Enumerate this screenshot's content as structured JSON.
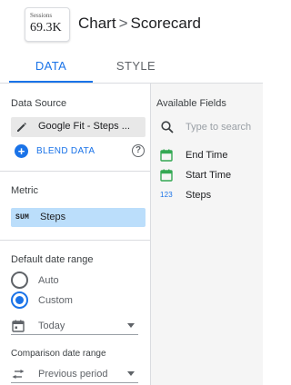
{
  "header": {
    "thumbnail": {
      "label": "Sessions",
      "value": "69.3K"
    },
    "breadcrumb": [
      "Chart",
      "Scorecard"
    ],
    "separator": ">"
  },
  "tabs": [
    {
      "label": "DATA",
      "active": true
    },
    {
      "label": "STYLE",
      "active": false
    }
  ],
  "data_source": {
    "title": "Data Source",
    "source_name": "Google Fit - Steps ...",
    "blend_label": "BLEND DATA",
    "help_glyph": "?"
  },
  "metric": {
    "title": "Metric",
    "badge": "SUM",
    "field": "Steps"
  },
  "date_range": {
    "title": "Default date range",
    "options": [
      {
        "label": "Auto",
        "checked": false
      },
      {
        "label": "Custom",
        "checked": true
      }
    ],
    "custom_value": "Today"
  },
  "comparison": {
    "title": "Comparison date range",
    "value": "Previous period"
  },
  "available_fields": {
    "title": "Available Fields",
    "search_placeholder": "Type to search",
    "fields": [
      {
        "name": "End Time",
        "type": "date",
        "icon": "calendar-icon"
      },
      {
        "name": "Start Time",
        "type": "date",
        "icon": "calendar-icon"
      },
      {
        "name": "Steps",
        "type": "number",
        "type_glyph": "123",
        "icon": "number-icon"
      }
    ]
  },
  "colors": {
    "accent": "#1a73e8",
    "metric_chip": "#bbdefb",
    "date_icon": "#34a853",
    "right_panel": "#f5f5f5"
  }
}
